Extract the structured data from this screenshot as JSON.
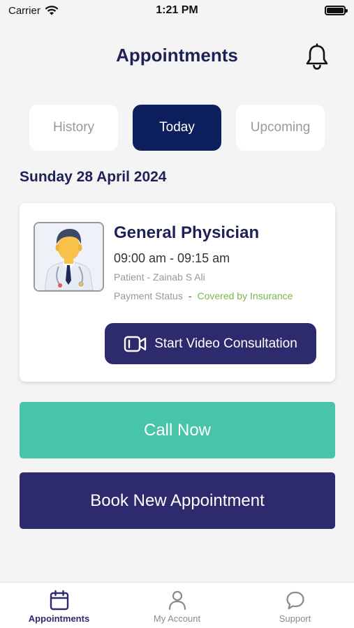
{
  "status_bar": {
    "carrier": "Carrier",
    "time": "1:21 PM"
  },
  "header": {
    "title": "Appointments"
  },
  "tabs": [
    {
      "label": "History",
      "active": false
    },
    {
      "label": "Today",
      "active": true
    },
    {
      "label": "Upcoming",
      "active": false
    }
  ],
  "date_heading": "Sunday 28 April 2024",
  "appointment": {
    "specialty": "General Physician",
    "time_range": "09:00 am - 09:15 am",
    "patient": "Patient - Zainab S Ali",
    "payment_label": "Payment Status",
    "payment_sep": "-",
    "payment_value": "Covered by Insurance",
    "video_button": "Start Video Consultation"
  },
  "actions": {
    "call_now": "Call Now",
    "book_new": "Book New Appointment"
  },
  "bottom_nav": [
    {
      "label": "Appointments",
      "icon": "calendar-icon",
      "active": true
    },
    {
      "label": "My Account",
      "icon": "person-icon",
      "active": false
    },
    {
      "label": "Support",
      "icon": "chat-bubble-icon",
      "active": false
    }
  ],
  "colors": {
    "primary": "#2d2a6e",
    "tab_active": "#0d1f5c",
    "call_green": "#48c4a8",
    "insurance_green": "#7ab648",
    "background": "#f4f4f4"
  }
}
